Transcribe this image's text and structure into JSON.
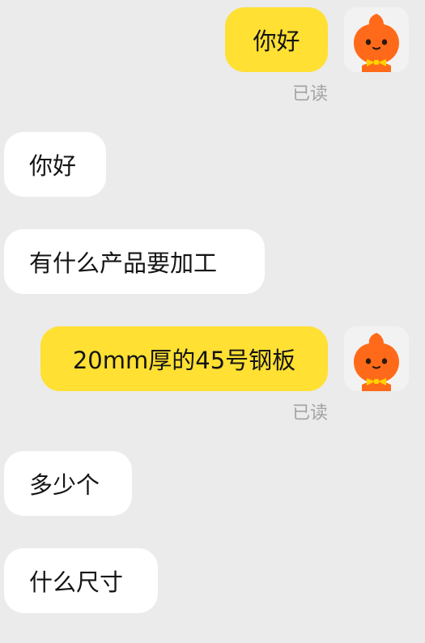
{
  "messages": [
    {
      "side": "out",
      "text": "你好",
      "status": "已读"
    },
    {
      "side": "in",
      "text": "你好"
    },
    {
      "side": "in",
      "text": "有什么产品要加工"
    },
    {
      "side": "out",
      "text": "20mm厚的45号钢板",
      "status": "已读"
    },
    {
      "side": "in",
      "text": "多少个"
    },
    {
      "side": "in",
      "text": "什么尺寸"
    }
  ],
  "colors": {
    "background": "#ebebeb",
    "outgoing_bubble": "#ffe033",
    "incoming_bubble": "#ffffff",
    "avatar_character": "#ff6a1a",
    "bow_tie": "#ffd200",
    "read_status": "#a3a3a3"
  },
  "icons": {
    "avatar": "orange-mascot-avatar-icon"
  }
}
